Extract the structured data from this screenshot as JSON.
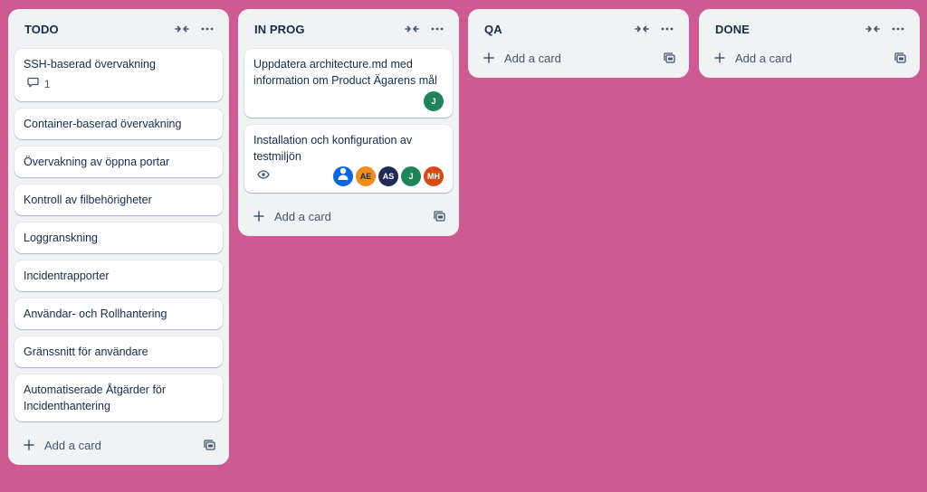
{
  "colors": {
    "board_bg": "#cd5a91",
    "list_bg": "#f1f2f4",
    "card_bg": "#ffffff",
    "text": "#172b4d",
    "muted": "#44546f"
  },
  "lists": [
    {
      "title": "TODO",
      "add_label": "Add a card",
      "cards": [
        {
          "title": "SSH-baserad övervakning",
          "comments": "1"
        },
        {
          "title": "Container-baserad övervakning"
        },
        {
          "title": "Övervakning av öppna portar"
        },
        {
          "title": "Kontroll av filbehörigheter"
        },
        {
          "title": "Loggranskning"
        },
        {
          "title": "Incidentrapporter"
        },
        {
          "title": "Användar- och Rollhantering"
        },
        {
          "title": "Gränssnitt för användare"
        },
        {
          "title": "Automatiserade Åtgärder för Incidenthantering"
        }
      ]
    },
    {
      "title": "IN PROG",
      "add_label": "Add a card",
      "cards": [
        {
          "title": "Uppdatera architecture.md med information om Product Ägarens mål",
          "members": [
            {
              "initials": "J",
              "color": "#1f845a"
            }
          ]
        },
        {
          "title": "Installation och konfiguration av testmiljön",
          "watching": true,
          "members": [
            {
              "initials": "",
              "color": "#0c66e4",
              "icon": "person-icon"
            },
            {
              "initials": "AE",
              "color": "#f28c1b"
            },
            {
              "initials": "AS",
              "color": "#1f2c56"
            },
            {
              "initials": "J",
              "color": "#1f845a"
            },
            {
              "initials": "MH",
              "color": "#d64a15"
            }
          ]
        }
      ]
    },
    {
      "title": "QA",
      "add_label": "Add a card",
      "cards": []
    },
    {
      "title": "DONE",
      "add_label": "Add a card",
      "cards": []
    }
  ]
}
